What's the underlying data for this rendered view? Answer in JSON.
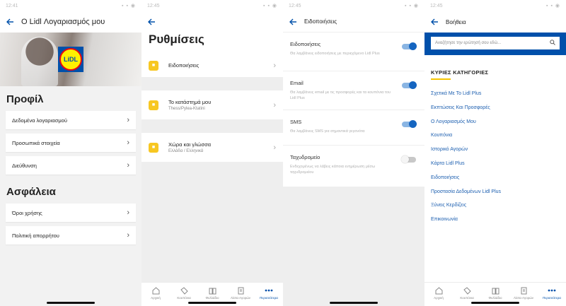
{
  "status_time": "12:41",
  "status_time2": "12:45",
  "screen1": {
    "title": "O Lidl Λογαριασμός μου",
    "logo_text": "LiDL",
    "profile_heading": "Προφίλ",
    "profile_items": [
      "Δεδομένα λογαριασμού",
      "Προσωπικά στοιχεία",
      "Διεύθυνση"
    ],
    "security_heading": "Ασφάλεια",
    "security_items": [
      "Όροι χρήσης",
      "Πολιτική απορρήτου"
    ]
  },
  "screen2": {
    "title": "Ρυθμίσεις",
    "rows": [
      {
        "title": "Ειδοποιήσεις",
        "subtitle": ""
      },
      {
        "title": "Το κατάστημά μου",
        "subtitle": "Thess/Pylea-Ktatini"
      },
      {
        "title": "Χώρα και γλώσσα",
        "subtitle": "Ελλάδα / Ελληνικά"
      }
    ]
  },
  "screen3": {
    "title": "Ειδοποιήσεις",
    "rows": [
      {
        "title": "Ειδοποιήσεις",
        "desc": "Θα λαμβάνεις ειδοποιήσεις με περιεχόμενο Lidl Plus",
        "on": true
      },
      {
        "title": "Email",
        "desc": "Θα λαμβάνεις email με τις προσφορές και τα κουπόνια του Lidl Plus",
        "on": true
      },
      {
        "title": "SMS",
        "desc": "Θα λαμβάνεις SMS για σημαντικά γεγονότα",
        "on": true
      },
      {
        "title": "Ταχυδρομείο",
        "desc": "Ενδεχομένως να λάβεις κάποια ενημέρωση μέσω ταχυδρομείου",
        "on": false
      }
    ]
  },
  "screen4": {
    "title": "Βοήθεια",
    "search_placeholder": "Αναζήτησε την ερώτησή σου εδώ...",
    "categories_heading": "ΚΥΡΙΕΣ ΚΑΤΗΓΟΡΙΕΣ",
    "categories": [
      "Σχετικά Με Το Lidl Plus",
      "Εκπτώσεις Και Προσφορές",
      "Ο Λογαριασμός Μου",
      "Κουπόνια",
      "Ιστορικό Αγορών",
      "Κάρτα Lidl Plus",
      "Ειδοποιήσεις",
      "Προστασία Δεδομένων Lidl Plus",
      "Ξύνεις Κερδίζεις",
      "Επικοινωνία"
    ]
  },
  "bottom_nav": [
    "Αρχική",
    "Κουπόνια",
    "Φυλλάδιο",
    "Λίστα Αγορών",
    "Περισσότερα"
  ],
  "colors": {
    "brand_blue": "#0050aa",
    "toggle_on": "#1565c0",
    "link": "#1c5fb0",
    "accent_yellow": "#f5c400"
  }
}
